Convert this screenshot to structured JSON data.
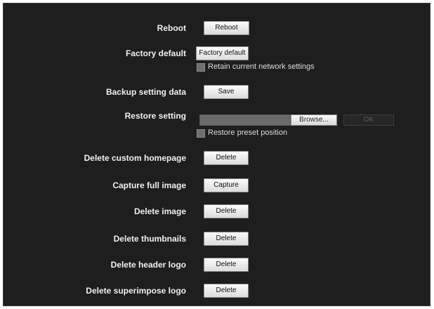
{
  "reboot": {
    "label": "Reboot",
    "button": "Reboot"
  },
  "factory_default": {
    "label": "Factory default",
    "button": "Factory default",
    "checkbox_label": "Retain current network settings",
    "checked": false
  },
  "backup": {
    "label": "Backup setting data",
    "button": "Save"
  },
  "restore": {
    "label": "Restore setting",
    "file_value": "",
    "browse_button": "Browse...",
    "ok_button": "OK",
    "checkbox_label": "Restore preset position",
    "checked": false
  },
  "delete_custom_homepage": {
    "label": "Delete custom homepage",
    "button": "Delete"
  },
  "capture_full_image": {
    "label": "Capture full image",
    "button": "Capture"
  },
  "delete_image": {
    "label": "Delete image",
    "button": "Delete"
  },
  "delete_thumbnails": {
    "label": "Delete thumbnails",
    "button": "Delete"
  },
  "delete_header_logo": {
    "label": "Delete header logo",
    "button": "Delete"
  },
  "delete_superimpose_logo": {
    "label": "Delete superimpose logo",
    "button": "Delete"
  },
  "colors": {
    "panel_background": "#1e1e1e",
    "label_text": "#f0f0f0",
    "checkbox_text": "#dcdcdc"
  }
}
